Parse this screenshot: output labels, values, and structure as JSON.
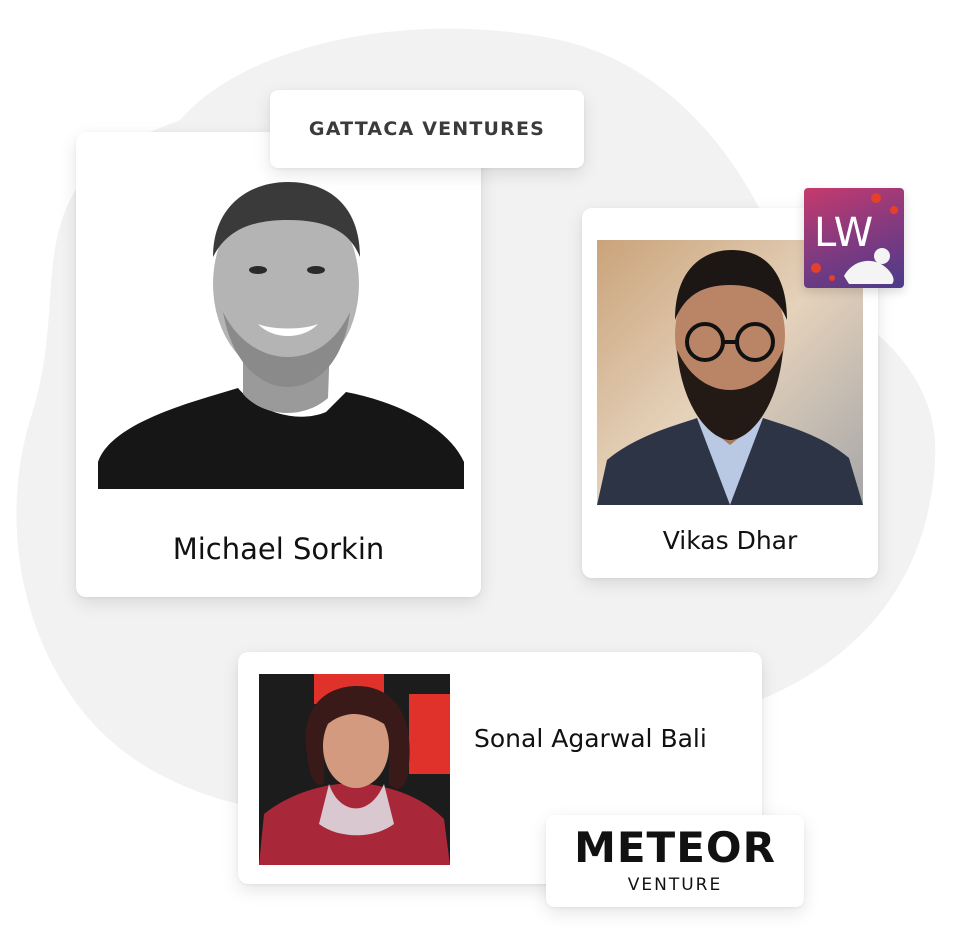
{
  "colors": {
    "background": "#ffffff",
    "blob": "#f2f2f2",
    "card": "#ffffff",
    "text": "#111111",
    "meteor_red_square": "#e0312a",
    "lw_badge_gradient_top": "#c63a6c",
    "lw_badge_gradient_bottom": "#4b3b8a"
  },
  "people": [
    {
      "name": "Michael Sorkin",
      "photo_icon": "portrait-photo-grayscale",
      "company_logo": {
        "text": "GATTACA VENTURES",
        "icon": "gattaca-ventures-logo"
      }
    },
    {
      "name": "Vikas Dhar",
      "photo_icon": "portrait-photo-color",
      "company_logo": {
        "text": "LW",
        "icon": "lw-badge-logo"
      }
    },
    {
      "name": "Sonal Agarwal Bali",
      "photo_icon": "portrait-photo-color",
      "company_logo": {
        "top": "METEOR",
        "bottom": "VENTURE",
        "icon": "meteor-venture-logo"
      }
    }
  ]
}
